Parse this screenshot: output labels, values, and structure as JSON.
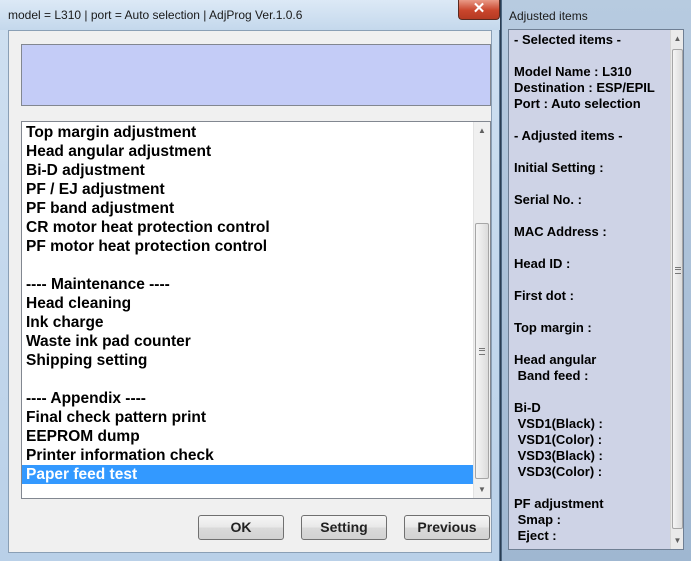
{
  "main_window": {
    "title": "model = L310 | port = Auto selection | AdjProg Ver.1.0.6",
    "close_glyph": "✕",
    "message_text": "",
    "menu_items": [
      {
        "label": "Top margin adjustment",
        "selected": false
      },
      {
        "label": "Head angular adjustment",
        "selected": false
      },
      {
        "label": "Bi-D adjustment",
        "selected": false
      },
      {
        "label": "PF / EJ adjustment",
        "selected": false
      },
      {
        "label": "PF band adjustment",
        "selected": false
      },
      {
        "label": "CR motor heat protection control",
        "selected": false
      },
      {
        "label": "PF motor heat protection control",
        "selected": false
      },
      {
        "label": "",
        "selected": false
      },
      {
        "label": "---- Maintenance ----",
        "selected": false
      },
      {
        "label": "Head cleaning",
        "selected": false
      },
      {
        "label": "Ink charge",
        "selected": false
      },
      {
        "label": "Waste ink pad counter",
        "selected": false
      },
      {
        "label": "Shipping setting",
        "selected": false
      },
      {
        "label": "",
        "selected": false
      },
      {
        "label": "---- Appendix ----",
        "selected": false
      },
      {
        "label": "Final check pattern print",
        "selected": false
      },
      {
        "label": "EEPROM dump",
        "selected": false
      },
      {
        "label": "Printer information check",
        "selected": false
      },
      {
        "label": "Paper feed test",
        "selected": true
      }
    ],
    "buttons": {
      "ok": "OK",
      "setting": "Setting",
      "previous": "Previous"
    }
  },
  "adjusted_window": {
    "title": "Adjusted items",
    "lines": [
      "- Selected items -",
      "",
      "Model Name : L310",
      "Destination : ESP/EPIL",
      "Port : Auto selection",
      "",
      "- Adjusted items -",
      "",
      "Initial Setting :",
      "",
      "Serial No. :",
      "",
      "MAC Address :",
      "",
      "Head ID :",
      "",
      "First dot :",
      "",
      "Top margin :",
      "",
      "Head angular",
      " Band feed :",
      "",
      "Bi-D",
      " VSD1(Black) :",
      " VSD1(Color) :",
      " VSD3(Black) :",
      " VSD3(Color) :",
      "",
      "PF adjustment",
      " Smap :",
      " Eject :"
    ]
  },
  "colors": {
    "selection": "#3399ff",
    "message_panel": "#c4ccf7",
    "adjusted_panel": "#ced3e6",
    "close_button": "#c9452c"
  },
  "icons": {
    "close": "close-icon",
    "scroll_up": "scroll-up-arrow-icon",
    "scroll_down": "scroll-down-arrow-icon"
  }
}
